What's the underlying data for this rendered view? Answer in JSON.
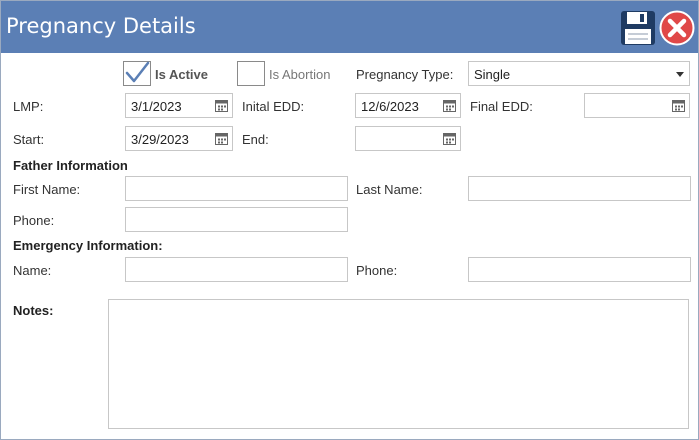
{
  "window": {
    "title": "Pregnancy Details",
    "colors": {
      "titlebar": "#5b7fb5",
      "close": "#e04848",
      "save": "#1f3b63"
    },
    "icons": {
      "save": "floppy-disk-icon",
      "close": "close-circle-icon"
    }
  },
  "status": {
    "is_active_label": "Is Active",
    "is_active_checked": true,
    "is_abortion_label": "Is Abortion",
    "is_abortion_checked": false,
    "pregnancy_type_label": "Pregnancy Type:",
    "pregnancy_type_value": "Single"
  },
  "dates": {
    "lmp_label": "LMP:",
    "lmp_value": "3/1/2023",
    "initial_edd_label": "Inital EDD:",
    "initial_edd_value": "12/6/2023",
    "final_edd_label": "Final EDD:",
    "final_edd_value": "",
    "start_label": "Start:",
    "start_value": "3/29/2023",
    "end_label": "End:",
    "end_value": ""
  },
  "father": {
    "section_title": "Father Information",
    "first_name_label": "First Name:",
    "first_name_value": "",
    "last_name_label": "Last Name:",
    "last_name_value": "",
    "phone_label": "Phone:",
    "phone_value": ""
  },
  "emergency": {
    "section_title": "Emergency Information:",
    "name_label": "Name:",
    "name_value": "",
    "phone_label": "Phone:",
    "phone_value": ""
  },
  "notes": {
    "label": "Notes:",
    "value": ""
  }
}
